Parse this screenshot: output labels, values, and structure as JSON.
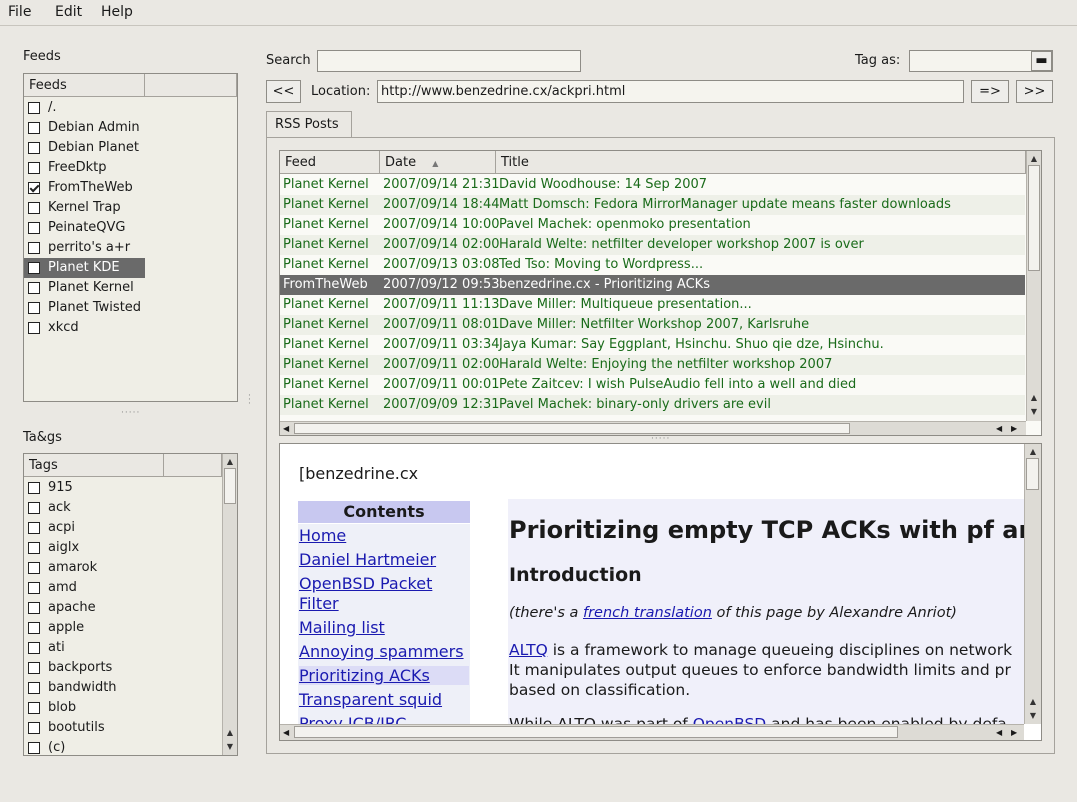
{
  "menubar": {
    "file": "File",
    "edit": "Edit",
    "help": "Help"
  },
  "feeds_panel": {
    "title": "Feeds",
    "column": "Feeds",
    "items": [
      {
        "label": "/.",
        "checked": false
      },
      {
        "label": "Debian Admin",
        "checked": false
      },
      {
        "label": "Debian Planet",
        "checked": false
      },
      {
        "label": "FreeDktp",
        "checked": false
      },
      {
        "label": "FromTheWeb",
        "checked": true
      },
      {
        "label": "Kernel Trap",
        "checked": false
      },
      {
        "label": "PeinateQVG",
        "checked": false
      },
      {
        "label": "perrito's a+r",
        "checked": false
      },
      {
        "label": "Planet KDE",
        "checked": false,
        "selected": true
      },
      {
        "label": "Planet Kernel",
        "checked": false
      },
      {
        "label": "Planet Twisted",
        "checked": false
      },
      {
        "label": "xkcd",
        "checked": false
      }
    ]
  },
  "tags_panel": {
    "title": "Ta&gs",
    "column": "Tags",
    "items": [
      "915",
      "ack",
      "acpi",
      "aiglx",
      "amarok",
      "amd",
      "apache",
      "apple",
      "ati",
      "backports",
      "bandwidth",
      "blob",
      "bootutils",
      "(c)"
    ]
  },
  "search": {
    "label": "Search",
    "value": ""
  },
  "tag_as": {
    "label": "Tag as:",
    "value": ""
  },
  "location": {
    "back": "<<",
    "label": "Location:",
    "url": "http://www.benzedrine.cx/ackpri.html",
    "go": "=>",
    "forward": ">>"
  },
  "tab": {
    "label": "RSS Posts"
  },
  "posts": {
    "columns": {
      "feed": "Feed",
      "date": "Date",
      "title": "Title"
    },
    "rows": [
      {
        "feed": "Planet Kernel",
        "date": "2007/09/14 21:31",
        "title": "David Woodhouse: 14 Sep 2007"
      },
      {
        "feed": "Planet Kernel",
        "date": "2007/09/14 18:44",
        "title": "Matt Domsch: Fedora MirrorManager update means faster downloads"
      },
      {
        "feed": "Planet Kernel",
        "date": "2007/09/14 10:00",
        "title": "Pavel Machek: openmoko presentation"
      },
      {
        "feed": "Planet Kernel",
        "date": "2007/09/14 02:00",
        "title": "Harald Welte: netfilter developer workshop 2007 is over"
      },
      {
        "feed": "Planet Kernel",
        "date": "2007/09/13 03:08",
        "title": "Ted Tso: Moving to Wordpress..."
      },
      {
        "feed": "FromTheWeb",
        "date": "2007/09/12 09:53",
        "title": "benzedrine.cx - Prioritizing ACKs",
        "selected": true
      },
      {
        "feed": "Planet Kernel",
        "date": "2007/09/11 11:13",
        "title": "Dave Miller: Multiqueue presentation..."
      },
      {
        "feed": "Planet Kernel",
        "date": "2007/09/11 08:01",
        "title": "Dave Miller: Netfilter Workshop 2007, Karlsruhe"
      },
      {
        "feed": "Planet Kernel",
        "date": "2007/09/11 03:34",
        "title": "Jaya Kumar: Say Eggplant, Hsinchu. Shuo qie dze, Hsinchu."
      },
      {
        "feed": "Planet Kernel",
        "date": "2007/09/11 02:00",
        "title": "Harald Welte: Enjoying the netfilter workshop 2007"
      },
      {
        "feed": "Planet Kernel",
        "date": "2007/09/11 00:01",
        "title": "Pete Zaitcev: I wish PulseAudio fell into a well and died"
      },
      {
        "feed": "Planet Kernel",
        "date": "2007/09/09 12:31",
        "title": "Pavel Machek: binary-only drivers are evil"
      }
    ]
  },
  "webview": {
    "site": "[benzedrine.cx",
    "contents_title": "Contents",
    "nav": [
      "Home",
      "Daniel Hartmeier",
      "OpenBSD Packet",
      "Filter",
      "Mailing list",
      "Annoying spammers",
      "Prioritizing ACKs",
      "Transparent squid",
      "Proxy ICB/IRC"
    ],
    "heading": "Prioritizing empty TCP ACKs with pf an",
    "subheading": "Introduction",
    "italic_pre": "(there's a ",
    "italic_link": "french translation",
    "italic_post": " of this page by Alexandre Anriot)",
    "altq_link": "ALTQ",
    "para1_rest": " is a framework to manage queueing disciplines on network",
    "para1_line2": "It manipulates output queues to enforce bandwidth limits and pr",
    "para1_line3": "based on classification.",
    "para2_pre": "While ALTQ was part of ",
    "para2_link": "OpenBSD",
    "para2_post": " and has been enabled by defa"
  },
  "colors": {
    "green_text": "#1a6b1a",
    "selected_row": "#6a6a6a",
    "link": "#1a1ab0",
    "contents_bg": "#c8c8f0",
    "selected_feed_bg": "#6a6a6a"
  }
}
